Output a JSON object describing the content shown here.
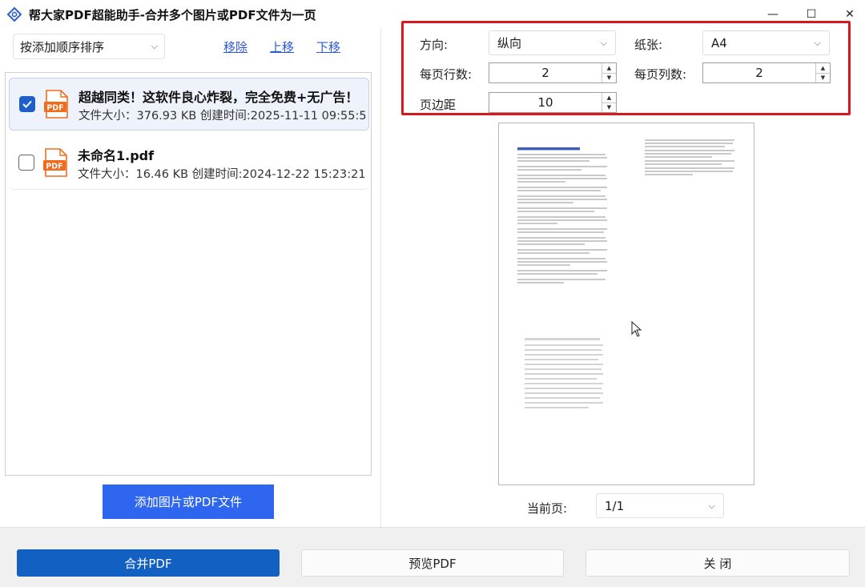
{
  "window": {
    "title": "帮大家PDF超能助手-合并多个图片或PDF文件为一页",
    "app_icon": "diamond-crosshair-icon",
    "controls": {
      "minimize": "—",
      "maximize": "☐",
      "close": "✕"
    }
  },
  "left": {
    "sort_select": {
      "value": "按添加顺序排序"
    },
    "links": {
      "remove": "移除",
      "up": "上移",
      "down": "下移"
    },
    "files": [
      {
        "name": "超越同类！这软件良心炸裂，完全免费+无广告！",
        "meta": "文件大小：376.93 KB 创建时间:2025-11-11 09:55:5",
        "checked": true,
        "icon_text": "PDF"
      },
      {
        "name": "未命名1.pdf",
        "meta": "文件大小：16.46 KB 创建时间:2024-12-22 15:23:21",
        "checked": false,
        "icon_text": "PDF"
      }
    ],
    "add_button": "添加图片或PDF文件"
  },
  "settings": {
    "orientation": {
      "label": "方向:",
      "value": "纵向"
    },
    "paper": {
      "label": "纸张:",
      "value": "A4"
    },
    "rows": {
      "label": "每页行数:",
      "value": "2"
    },
    "cols": {
      "label": "每页列数:",
      "value": "2"
    },
    "margin": {
      "label": "页边距",
      "value": "10"
    }
  },
  "preview": {
    "page_label": "当前页:",
    "page_value": "1/1"
  },
  "buttons": {
    "merge": "合并PDF",
    "preview": "预览PDF",
    "close": "关 闭"
  },
  "colors": {
    "accent_blue": "#1260c2",
    "add_blue": "#2e66f0",
    "highlight_red": "#d7191f",
    "link_blue": "#2b57d6",
    "pdf_orange": "#f26b1d"
  }
}
